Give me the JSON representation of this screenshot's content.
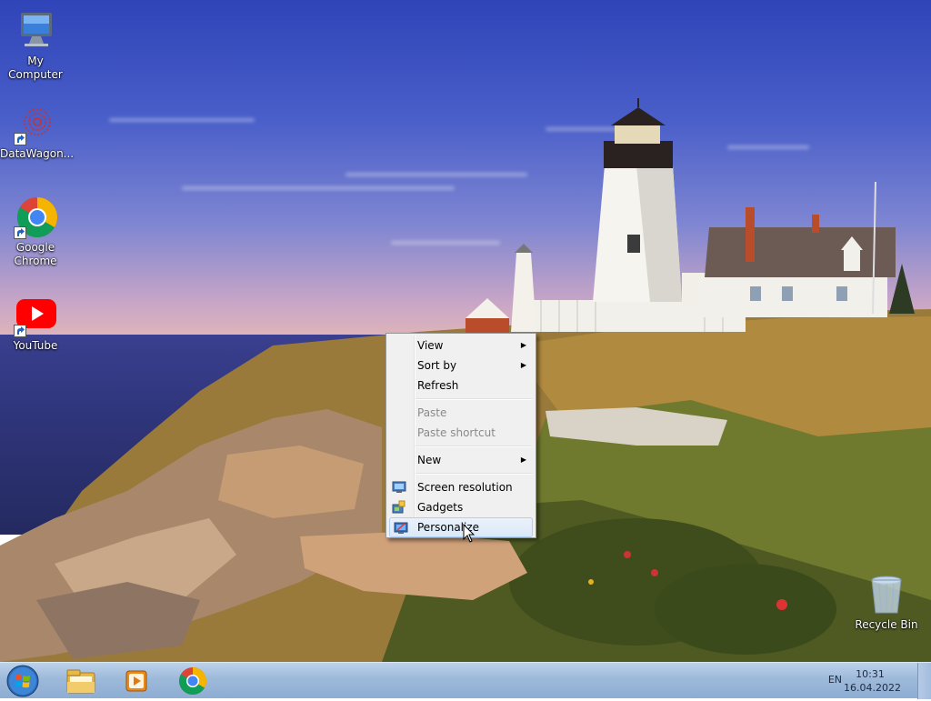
{
  "desktop": {
    "icons": [
      {
        "label": "My Computer",
        "icon": "computer-icon"
      },
      {
        "label": "DataWagon...",
        "icon": "datawagon-icon"
      },
      {
        "label": "Google\nChrome",
        "icon": "chrome-icon"
      },
      {
        "label": "YouTube",
        "icon": "youtube-icon"
      },
      {
        "label": "Recycle Bin",
        "icon": "recycle-bin-icon"
      }
    ]
  },
  "context_menu": {
    "items": [
      {
        "label": "View",
        "submenu": true,
        "enabled": true
      },
      {
        "label": "Sort by",
        "submenu": true,
        "enabled": true
      },
      {
        "label": "Refresh",
        "submenu": false,
        "enabled": true
      },
      {
        "label": "Paste",
        "submenu": false,
        "enabled": false
      },
      {
        "label": "Paste shortcut",
        "submenu": false,
        "enabled": false
      },
      {
        "label": "New",
        "submenu": true,
        "enabled": true
      },
      {
        "label": "Screen resolution",
        "submenu": false,
        "enabled": true,
        "icon": "screen-resolution-icon"
      },
      {
        "label": "Gadgets",
        "submenu": false,
        "enabled": true,
        "icon": "gadgets-icon"
      },
      {
        "label": "Personalize",
        "submenu": false,
        "enabled": true,
        "icon": "personalize-icon",
        "hovered": true
      }
    ],
    "submenu_arrow": "▶"
  },
  "taskbar": {
    "pinned": [
      "explorer-icon",
      "media-player-icon",
      "chrome-icon"
    ],
    "language": "EN",
    "time": "10:31",
    "date": "16.04.2022"
  },
  "colors": {
    "menu_bg": "#f0f0f0",
    "menu_hover": "#dbe9f8",
    "taskbar": "#9db9da"
  }
}
